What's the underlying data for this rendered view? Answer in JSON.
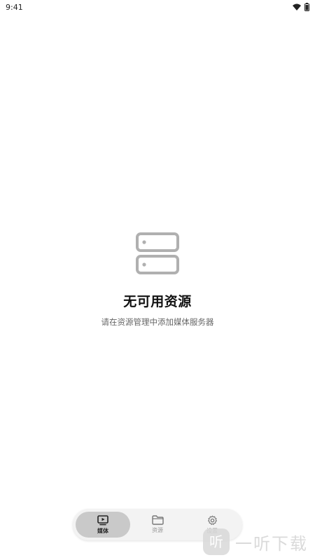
{
  "status_bar": {
    "time": "9:41"
  },
  "empty_state": {
    "icon": "server-icon",
    "title": "无可用资源",
    "subtitle": "请在资源管理中添加媒体服务器"
  },
  "bottom_nav": {
    "items": [
      {
        "label": "媒体",
        "icon": "media-icon",
        "active": true
      },
      {
        "label": "资源",
        "icon": "folder-icon",
        "active": false
      },
      {
        "label": "设置",
        "icon": "gear-icon",
        "active": false
      }
    ]
  },
  "watermark": {
    "text": "一听下载",
    "logo_text": "听"
  }
}
